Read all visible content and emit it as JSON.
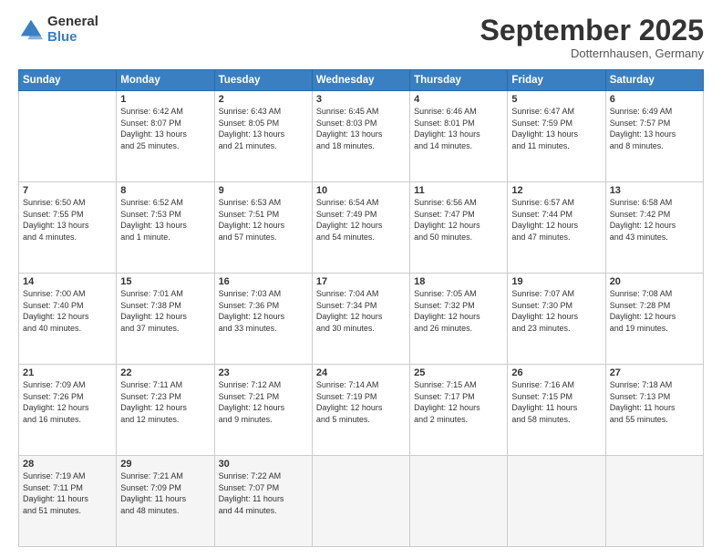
{
  "logo": {
    "general": "General",
    "blue": "Blue"
  },
  "header": {
    "month": "September 2025",
    "location": "Dotternhausen, Germany"
  },
  "weekdays": [
    "Sunday",
    "Monday",
    "Tuesday",
    "Wednesday",
    "Thursday",
    "Friday",
    "Saturday"
  ],
  "weeks": [
    [
      {
        "day": "",
        "info": ""
      },
      {
        "day": "1",
        "info": "Sunrise: 6:42 AM\nSunset: 8:07 PM\nDaylight: 13 hours\nand 25 minutes."
      },
      {
        "day": "2",
        "info": "Sunrise: 6:43 AM\nSunset: 8:05 PM\nDaylight: 13 hours\nand 21 minutes."
      },
      {
        "day": "3",
        "info": "Sunrise: 6:45 AM\nSunset: 8:03 PM\nDaylight: 13 hours\nand 18 minutes."
      },
      {
        "day": "4",
        "info": "Sunrise: 6:46 AM\nSunset: 8:01 PM\nDaylight: 13 hours\nand 14 minutes."
      },
      {
        "day": "5",
        "info": "Sunrise: 6:47 AM\nSunset: 7:59 PM\nDaylight: 13 hours\nand 11 minutes."
      },
      {
        "day": "6",
        "info": "Sunrise: 6:49 AM\nSunset: 7:57 PM\nDaylight: 13 hours\nand 8 minutes."
      }
    ],
    [
      {
        "day": "7",
        "info": "Sunrise: 6:50 AM\nSunset: 7:55 PM\nDaylight: 13 hours\nand 4 minutes."
      },
      {
        "day": "8",
        "info": "Sunrise: 6:52 AM\nSunset: 7:53 PM\nDaylight: 13 hours\nand 1 minute."
      },
      {
        "day": "9",
        "info": "Sunrise: 6:53 AM\nSunset: 7:51 PM\nDaylight: 12 hours\nand 57 minutes."
      },
      {
        "day": "10",
        "info": "Sunrise: 6:54 AM\nSunset: 7:49 PM\nDaylight: 12 hours\nand 54 minutes."
      },
      {
        "day": "11",
        "info": "Sunrise: 6:56 AM\nSunset: 7:47 PM\nDaylight: 12 hours\nand 50 minutes."
      },
      {
        "day": "12",
        "info": "Sunrise: 6:57 AM\nSunset: 7:44 PM\nDaylight: 12 hours\nand 47 minutes."
      },
      {
        "day": "13",
        "info": "Sunrise: 6:58 AM\nSunset: 7:42 PM\nDaylight: 12 hours\nand 43 minutes."
      }
    ],
    [
      {
        "day": "14",
        "info": "Sunrise: 7:00 AM\nSunset: 7:40 PM\nDaylight: 12 hours\nand 40 minutes."
      },
      {
        "day": "15",
        "info": "Sunrise: 7:01 AM\nSunset: 7:38 PM\nDaylight: 12 hours\nand 37 minutes."
      },
      {
        "day": "16",
        "info": "Sunrise: 7:03 AM\nSunset: 7:36 PM\nDaylight: 12 hours\nand 33 minutes."
      },
      {
        "day": "17",
        "info": "Sunrise: 7:04 AM\nSunset: 7:34 PM\nDaylight: 12 hours\nand 30 minutes."
      },
      {
        "day": "18",
        "info": "Sunrise: 7:05 AM\nSunset: 7:32 PM\nDaylight: 12 hours\nand 26 minutes."
      },
      {
        "day": "19",
        "info": "Sunrise: 7:07 AM\nSunset: 7:30 PM\nDaylight: 12 hours\nand 23 minutes."
      },
      {
        "day": "20",
        "info": "Sunrise: 7:08 AM\nSunset: 7:28 PM\nDaylight: 12 hours\nand 19 minutes."
      }
    ],
    [
      {
        "day": "21",
        "info": "Sunrise: 7:09 AM\nSunset: 7:26 PM\nDaylight: 12 hours\nand 16 minutes."
      },
      {
        "day": "22",
        "info": "Sunrise: 7:11 AM\nSunset: 7:23 PM\nDaylight: 12 hours\nand 12 minutes."
      },
      {
        "day": "23",
        "info": "Sunrise: 7:12 AM\nSunset: 7:21 PM\nDaylight: 12 hours\nand 9 minutes."
      },
      {
        "day": "24",
        "info": "Sunrise: 7:14 AM\nSunset: 7:19 PM\nDaylight: 12 hours\nand 5 minutes."
      },
      {
        "day": "25",
        "info": "Sunrise: 7:15 AM\nSunset: 7:17 PM\nDaylight: 12 hours\nand 2 minutes."
      },
      {
        "day": "26",
        "info": "Sunrise: 7:16 AM\nSunset: 7:15 PM\nDaylight: 11 hours\nand 58 minutes."
      },
      {
        "day": "27",
        "info": "Sunrise: 7:18 AM\nSunset: 7:13 PM\nDaylight: 11 hours\nand 55 minutes."
      }
    ],
    [
      {
        "day": "28",
        "info": "Sunrise: 7:19 AM\nSunset: 7:11 PM\nDaylight: 11 hours\nand 51 minutes."
      },
      {
        "day": "29",
        "info": "Sunrise: 7:21 AM\nSunset: 7:09 PM\nDaylight: 11 hours\nand 48 minutes."
      },
      {
        "day": "30",
        "info": "Sunrise: 7:22 AM\nSunset: 7:07 PM\nDaylight: 11 hours\nand 44 minutes."
      },
      {
        "day": "",
        "info": ""
      },
      {
        "day": "",
        "info": ""
      },
      {
        "day": "",
        "info": ""
      },
      {
        "day": "",
        "info": ""
      }
    ]
  ]
}
